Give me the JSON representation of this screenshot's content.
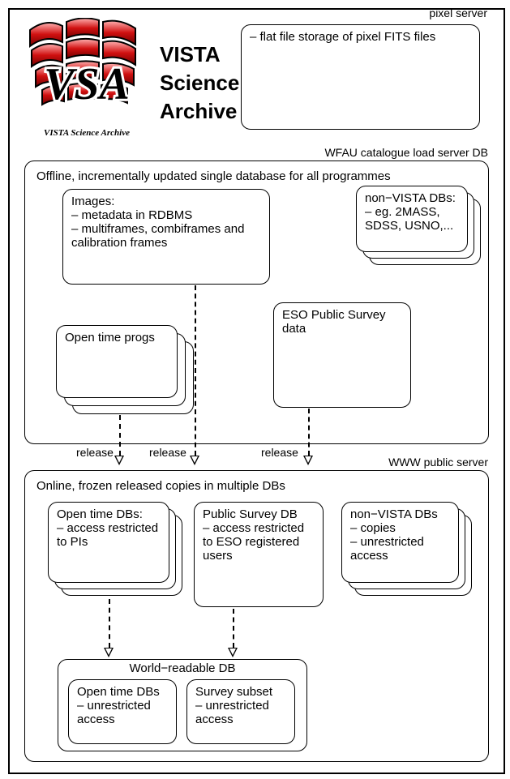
{
  "header": {
    "title_line1": "VISTA",
    "title_line2": "Science",
    "title_line3": "Archive",
    "logo_caption": "VISTA Science Archive",
    "logo_letters": "VSA"
  },
  "pixel_server": {
    "label": "pixel server",
    "item1": "flat file storage of pixel FITS files"
  },
  "wfau": {
    "label": "WFAU catalogue load server DB",
    "description": "Offline, incrementally updated single database for all programmes",
    "images_box": {
      "title": "Images:",
      "item1": "metadata in RDBMS",
      "item2": "multiframes, combiframes and calibration frames"
    },
    "nonvista_box": {
      "title": "non−VISTA DBs:",
      "item1": "eg. 2MASS, SDSS, USNO,..."
    },
    "open_time_progs": "Open time progs",
    "eso_box": "ESO Public Survey data"
  },
  "release_label": "release",
  "www": {
    "label": "WWW   public server",
    "description": "Online, frozen released copies in multiple DBs",
    "open_time_dbs": {
      "title": "Open time DBs:",
      "item1": "access restricted to PIs"
    },
    "public_survey": {
      "title": "Public Survey DB",
      "item1": "access restricted to ESO registered users"
    },
    "nonvista": {
      "title": "non−VISTA DBs",
      "item1": "copies",
      "item2": "unrestricted access"
    },
    "world_readable": {
      "title": "World−readable DB",
      "open_time": {
        "title": "Open time DBs",
        "item1": "unrestricted access"
      },
      "survey_subset": {
        "title": "Survey subset",
        "item1": "unrestricted access"
      }
    }
  }
}
